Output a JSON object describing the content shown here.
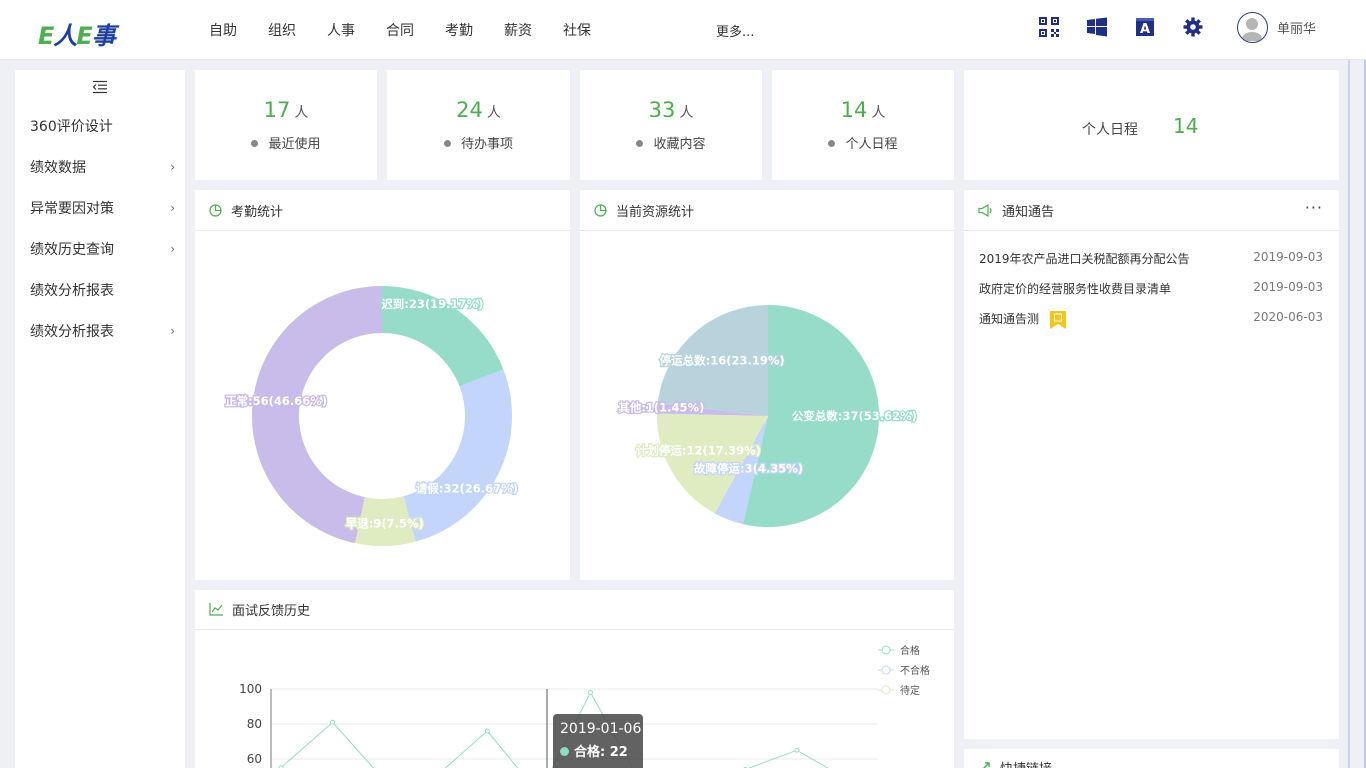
{
  "logo": {
    "e1": "E",
    "ren": "人",
    "e2": "E",
    "shi": "事"
  },
  "nav": {
    "items": [
      "自助",
      "组织",
      "人事",
      "合同",
      "考勤",
      "薪资",
      "社保"
    ],
    "more": "更多..."
  },
  "topbar": {
    "icons": [
      "qrcode-icon",
      "windows-icon",
      "font-icon",
      "gear-icon"
    ],
    "user_name": "单丽华"
  },
  "sidebar": {
    "items": [
      {
        "label": "360评价设计",
        "has_children": false
      },
      {
        "label": "绩效数据",
        "has_children": true
      },
      {
        "label": "异常要因对策",
        "has_children": true
      },
      {
        "label": "绩效历史查询",
        "has_children": true
      },
      {
        "label": "绩效分析报表",
        "has_children": false
      },
      {
        "label": "绩效分析报表",
        "has_children": true
      }
    ]
  },
  "stats": [
    {
      "value": "17",
      "unit": "人",
      "label": "最近使用"
    },
    {
      "value": "24",
      "unit": "人",
      "label": "待办事项"
    },
    {
      "value": "33",
      "unit": "人",
      "label": "收藏内容"
    },
    {
      "value": "14",
      "unit": "人",
      "label": "个人日程"
    }
  ],
  "schedule": {
    "label": "个人日程",
    "value": "14"
  },
  "panels": {
    "attendance": "考勤统计",
    "resource": "当前资源统计",
    "notice": "通知通告",
    "interview": "面试反馈历史",
    "quicklink": "快捷链接"
  },
  "notices": [
    {
      "title": "2019年农产品进口关税配额再分配公告",
      "date": "2019-09-03",
      "is_new": false
    },
    {
      "title": "政府定价的经营服务性收费目录清单",
      "date": "2019-09-03",
      "is_new": false
    },
    {
      "title": "通知通告测",
      "date": "2020-06-03",
      "is_new": true
    }
  ],
  "notice_more": "···",
  "tooltip": {
    "title": "2019-01-06",
    "series": "合格",
    "value": "22"
  },
  "colors": {
    "green": "#4cae4c",
    "teal": "#96dcc8",
    "blue": "#c3d5fa",
    "lime": "#dfecc2",
    "purple": "#c9bbea",
    "grayblue": "#b8d3dc",
    "brand_blue": "#1f3fa0"
  },
  "chart_data": [
    {
      "type": "pie",
      "title": "考勤统计",
      "donut": true,
      "slices": [
        {
          "label": "迟到:23(19.17%)",
          "value": 23,
          "color": "#96dcc8"
        },
        {
          "label": "请假:32(26.67%)",
          "value": 32,
          "color": "#c3d5fa"
        },
        {
          "label": "早退:9(7.5%)",
          "value": 9,
          "color": "#dfecc2"
        },
        {
          "label": "正常:56(46.66%)",
          "value": 56,
          "color": "#c9bbea"
        }
      ]
    },
    {
      "type": "pie",
      "title": "当前资源统计",
      "donut": false,
      "slices": [
        {
          "label": "公变总数:37(53.62%)",
          "value": 37,
          "color": "#96dcc8"
        },
        {
          "label": "故障停运:3(4.35%)",
          "value": 3,
          "color": "#c3d5fa"
        },
        {
          "label": "计划停运:12(17.39%)",
          "value": 12,
          "color": "#dfecc2"
        },
        {
          "label": "其他:1(1.45%)",
          "value": 1,
          "color": "#c9bbea"
        },
        {
          "label": "停运总数:16(23.19%)",
          "value": 16,
          "color": "#b8d3dc"
        }
      ]
    },
    {
      "type": "line",
      "title": "面试反馈历史",
      "y_ticks": [
        "100",
        "80",
        "60"
      ],
      "ylim": [
        0,
        100
      ],
      "series": [
        {
          "name": "合格",
          "color": "#96dcc8",
          "values": [
            55,
            81,
            48,
            50,
            76,
            40,
            98,
            45,
            42,
            54,
            65,
            48
          ]
        },
        {
          "name": "不合格",
          "color": "#c3d5fa",
          "values": []
        },
        {
          "name": "待定",
          "color": "#dfecc2",
          "values": []
        }
      ]
    }
  ]
}
